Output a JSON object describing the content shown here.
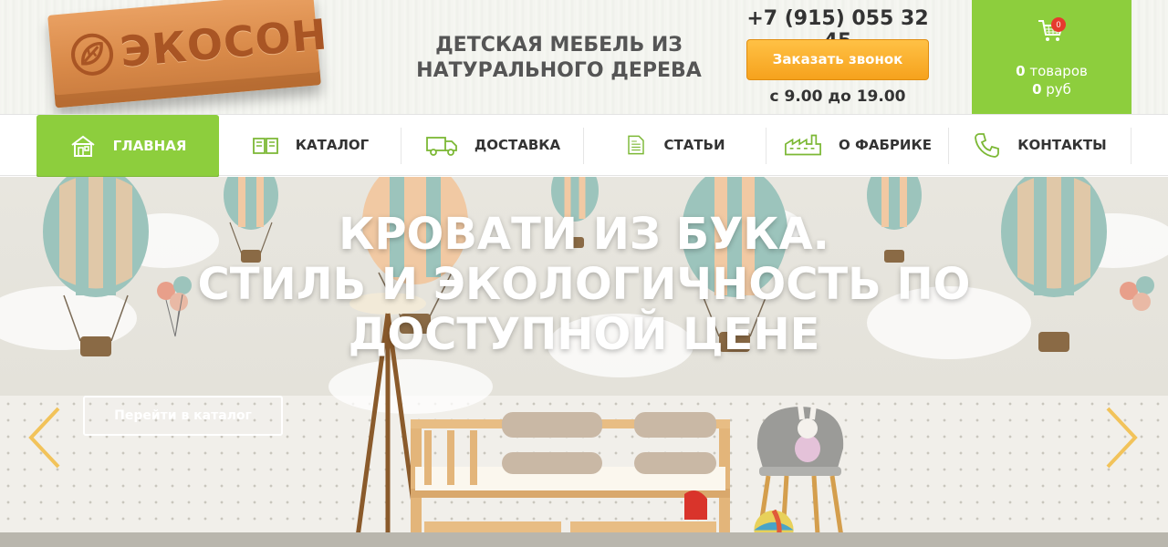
{
  "brand": {
    "logo_text": "ЭКОСОН",
    "tagline_line1": "ДЕТСКАЯ МЕБЕЛЬ ИЗ",
    "tagline_line2": "НАТУРАЛЬНОГО ДЕРЕВА"
  },
  "contact": {
    "phone": "+7 (915) 055 32 45",
    "call_button": "Заказать звонок",
    "hours": "с 9.00 до 19.00"
  },
  "cart": {
    "badge": "0",
    "items_count": "0",
    "items_label": "товаров",
    "sum": "0",
    "currency": "руб",
    "icon": "cart-icon"
  },
  "nav": {
    "items": [
      {
        "label": "ГЛАВНАЯ",
        "icon": "house-icon",
        "active": true
      },
      {
        "label": "КАТАЛОГ",
        "icon": "book-icon",
        "active": false
      },
      {
        "label": "ДОСТАВКА",
        "icon": "truck-icon",
        "active": false
      },
      {
        "label": "СТАТЬИ",
        "icon": "document-icon",
        "active": false
      },
      {
        "label": "О ФАБРИКЕ",
        "icon": "factory-icon",
        "active": false
      },
      {
        "label": "КОНТАКТЫ",
        "icon": "phone-icon",
        "active": false
      }
    ]
  },
  "hero": {
    "title_line1": "КРОВАТИ ИЗ БУКА.",
    "title_line2": "СТИЛЬ И ЭКОЛОГИЧНОСТЬ ПО",
    "title_line3": "ДОСТУПНОЙ ЦЕНЕ",
    "button": "Перейти в каталог"
  },
  "colors": {
    "accent_green": "#8dce3d",
    "button_orange": "#f6a21d",
    "arrow_yellow": "#f2c35a"
  }
}
